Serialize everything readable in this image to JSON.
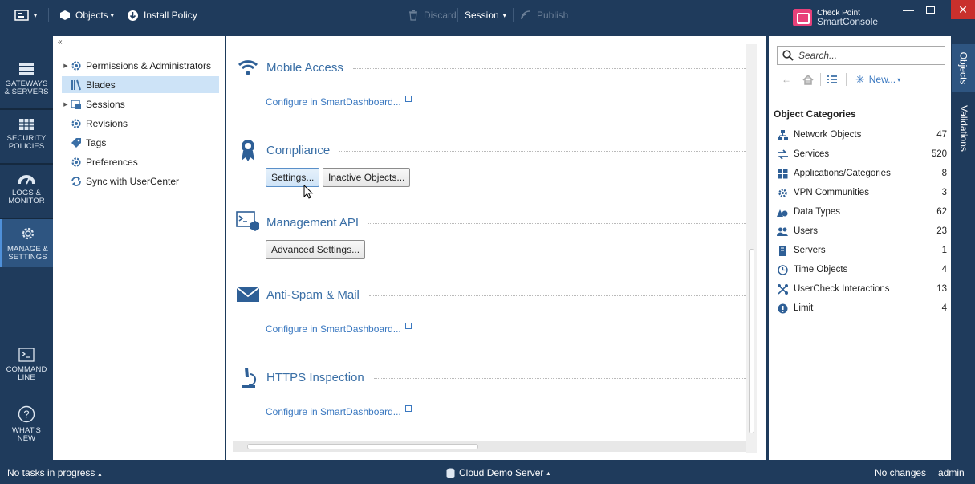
{
  "titlebar": {
    "objects_label": "Objects",
    "install_policy_label": "Install Policy",
    "discard_label": "Discard",
    "session_label": "Session",
    "publish_label": "Publish",
    "logo_line1": "Check Point",
    "logo_line2": "SmartConsole"
  },
  "leftnav": {
    "items": [
      {
        "label1": "GATEWAYS",
        "label2": "& SERVERS",
        "icon": "gateways-icon"
      },
      {
        "label1": "SECURITY",
        "label2": "POLICIES",
        "icon": "policies-icon"
      },
      {
        "label1": "LOGS &",
        "label2": "MONITOR",
        "icon": "gauge-icon"
      },
      {
        "label1": "MANAGE &",
        "label2": "SETTINGS",
        "icon": "gear-icon"
      },
      {
        "label1": "COMMAND",
        "label2": "LINE",
        "icon": "terminal-icon"
      },
      {
        "label1": "WHAT'S",
        "label2": "NEW",
        "icon": "question-icon"
      }
    ]
  },
  "tree": {
    "items": [
      {
        "label": "Permissions & Administrators"
      },
      {
        "label": "Blades"
      },
      {
        "label": "Sessions"
      },
      {
        "label": "Revisions"
      },
      {
        "label": "Tags"
      },
      {
        "label": "Preferences"
      },
      {
        "label": "Sync with UserCenter"
      }
    ]
  },
  "content": {
    "mobile_access": {
      "title": "Mobile Access",
      "link": "Configure in SmartDashboard..."
    },
    "compliance": {
      "title": "Compliance",
      "settings_btn": "Settings...",
      "inactive_btn": "Inactive Objects..."
    },
    "management_api": {
      "title": "Management API",
      "advanced_btn": "Advanced Settings..."
    },
    "anti_spam": {
      "title": "Anti-Spam & Mail",
      "link": "Configure in SmartDashboard..."
    },
    "https": {
      "title": "HTTPS Inspection",
      "link": "Configure in SmartDashboard..."
    }
  },
  "rightpane": {
    "search_placeholder": "Search...",
    "new_label": "New...",
    "categories_title": "Object Categories",
    "categories": [
      {
        "label": "Network Objects",
        "count": "47"
      },
      {
        "label": "Services",
        "count": "520"
      },
      {
        "label": "Applications/Categories",
        "count": "8"
      },
      {
        "label": "VPN Communities",
        "count": "3"
      },
      {
        "label": "Data Types",
        "count": "62"
      },
      {
        "label": "Users",
        "count": "23"
      },
      {
        "label": "Servers",
        "count": "1"
      },
      {
        "label": "Time Objects",
        "count": "4"
      },
      {
        "label": "UserCheck Interactions",
        "count": "13"
      },
      {
        "label": "Limit",
        "count": "4"
      }
    ]
  },
  "vtabs": {
    "objects": "Objects",
    "validations": "Validations"
  },
  "statusbar": {
    "tasks": "No tasks in progress",
    "server": "Cloud Demo Server",
    "changes": "No changes",
    "user": "admin"
  },
  "colors": {
    "navy": "#1f3b5c",
    "link": "#3a78c0",
    "title": "#3a6fa6",
    "close": "#c9302c"
  }
}
